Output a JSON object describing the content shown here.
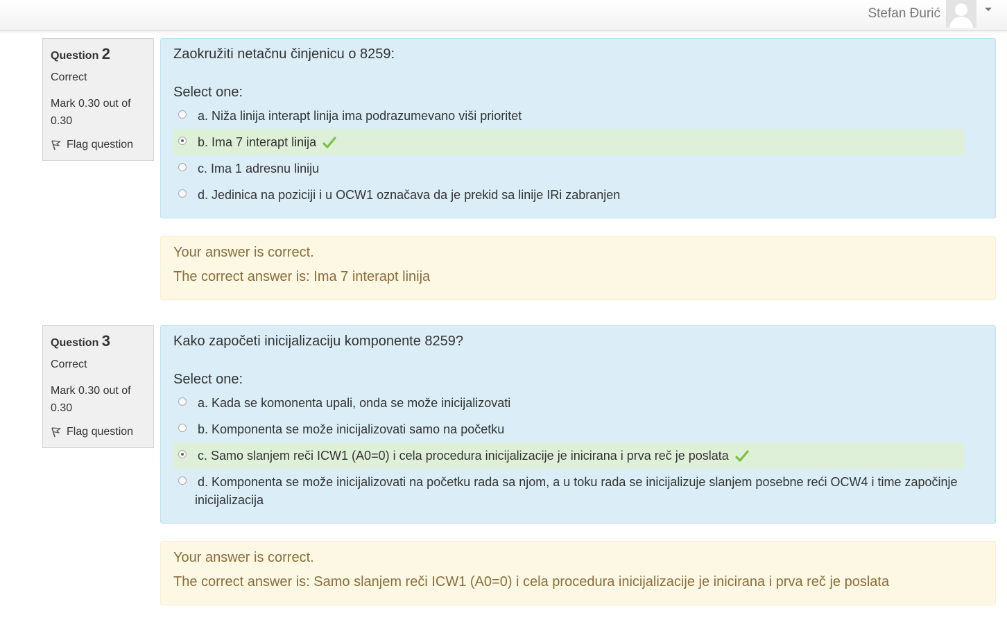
{
  "user": {
    "name": "Stefan Đurić",
    "avatar_icon": "user-avatar-icon"
  },
  "questions": [
    {
      "label": "Question",
      "number": "2",
      "state": "Correct",
      "grade": "Mark 0.30 out of 0.30",
      "flag": "Flag question",
      "text": "Zaokružiti netačnu činjenicu o 8259:",
      "prompt": "Select one:",
      "options": [
        "a. Niža linija interapt linija ima podrazumevano viši prioritet",
        "b. Ima 7 interapt linija",
        "c. Ima 1 adresnu liniju",
        "d. Jedinica na poziciji i u OCW1 označava da je prekid sa linije IRi zabranjen"
      ],
      "selected_option": "b",
      "feedback": "Your answer is correct.",
      "right_answer": "The correct answer is: Ima 7 interapt linija"
    },
    {
      "label": "Question",
      "number": "3",
      "state": "Correct",
      "grade": "Mark 0.30 out of 0.30",
      "flag": "Flag question",
      "text": "Kako započeti inicijalizaciju komponente 8259?",
      "prompt": "Select one:",
      "options": [
        "a. Kada se komonenta upali, onda se može inicijalizovati",
        "b. Komponenta se može inicijalizovati samo na početku",
        "c. Samo slanjem reči ICW1 (A0=0) i cela procedura inicijalizacije je inicirana i prva reč je poslata",
        "d. Komponenta se može inicijalizovati na početku rada sa njom, a u toku rada se inicijalizuje slanjem posebne reći OCW4 i time započinje inicijalizacija"
      ],
      "selected_option": "c",
      "feedback": "Your answer is correct.",
      "right_answer": "The correct answer is: Samo slanjem reči ICW1 (A0=0) i cela procedura inicijalizacije je inicirana i prva reč je poslata"
    }
  ],
  "colors": {
    "formulation_bg": "#dbedf6",
    "correct_bg": "#dff0d8",
    "feedback_bg": "#fcf8e3",
    "feedback_text": "#8a6d3b",
    "tick": "#7ac143"
  }
}
